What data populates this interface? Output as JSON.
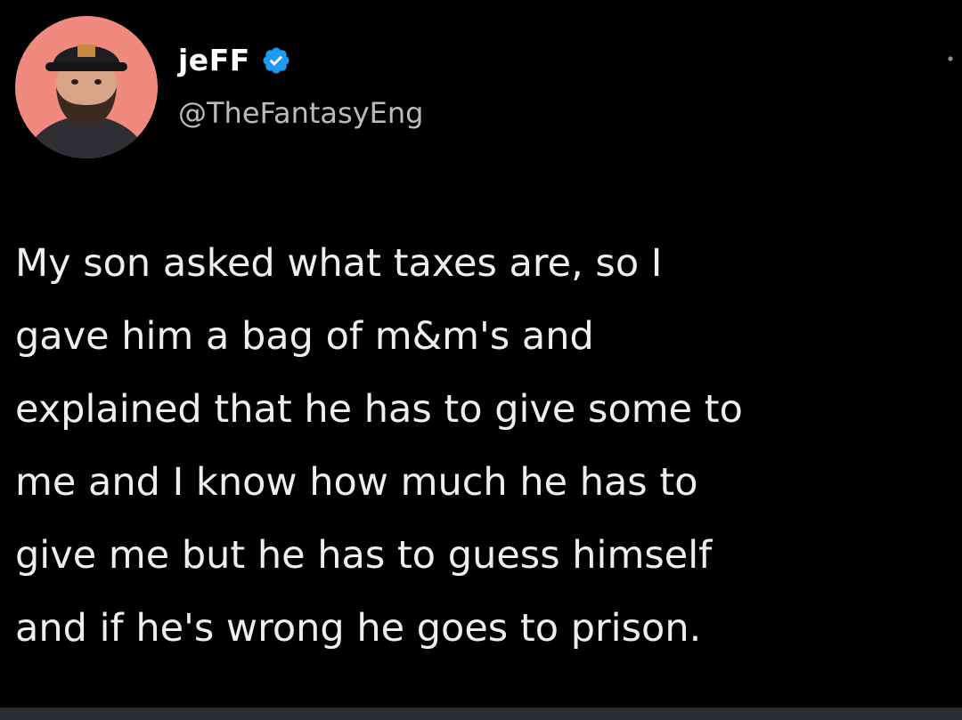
{
  "tweet": {
    "author": {
      "display_name": "jeFF",
      "handle": "@TheFantasyEng",
      "verified": true,
      "avatar_icon": "profile-photo",
      "avatar_bg": "#f08a7e",
      "verified_color": "#1d9bf0"
    },
    "text_lines": [
      "My son asked what taxes are, so I",
      "gave him a bag of m&m's and",
      "explained that he has to give some to",
      "me and I know how much he has to",
      "give me but he has to guess himself",
      "and if he's wrong he goes to prison."
    ],
    "menu_icon": "more-options-icon",
    "background": "#000000"
  }
}
